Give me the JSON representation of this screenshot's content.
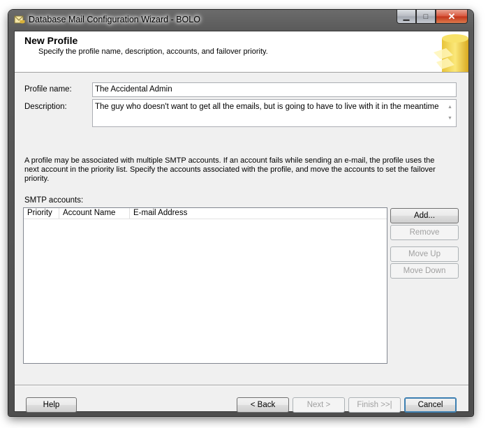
{
  "window": {
    "title": "Database Mail Configuration Wizard - BOLO",
    "controls": {
      "minimize": "▁",
      "maximize": "□",
      "close": "✕"
    }
  },
  "header": {
    "title": "New Profile",
    "subtitle": "Specify the profile name, description, accounts, and failover priority."
  },
  "form": {
    "profile_name_label": "Profile name:",
    "profile_name_value": "The Accidental Admin",
    "description_label": "Description:",
    "description_value": "The guy who doesn't want to get all the emails, but is going to have to live with it in the meantime"
  },
  "info_text": "A profile may be associated with multiple SMTP accounts. If an account fails while sending an e-mail, the profile uses the next account in the priority list. Specify the accounts associated with the profile, and move the accounts to set the failover priority.",
  "smtp": {
    "label": "SMTP accounts:",
    "columns": [
      "Priority",
      "Account Name",
      "E-mail Address"
    ],
    "rows": []
  },
  "side_buttons": {
    "add": "Add...",
    "remove": "Remove",
    "move_up": "Move Up",
    "move_down": "Move Down"
  },
  "footer_buttons": {
    "help": "Help",
    "back": "< Back",
    "next": "Next >",
    "finish": "Finish >>|",
    "cancel": "Cancel"
  },
  "colors": {
    "accent": "#3c7fb1",
    "close_button": "#c2341b",
    "frame": "#5a5a5a"
  }
}
